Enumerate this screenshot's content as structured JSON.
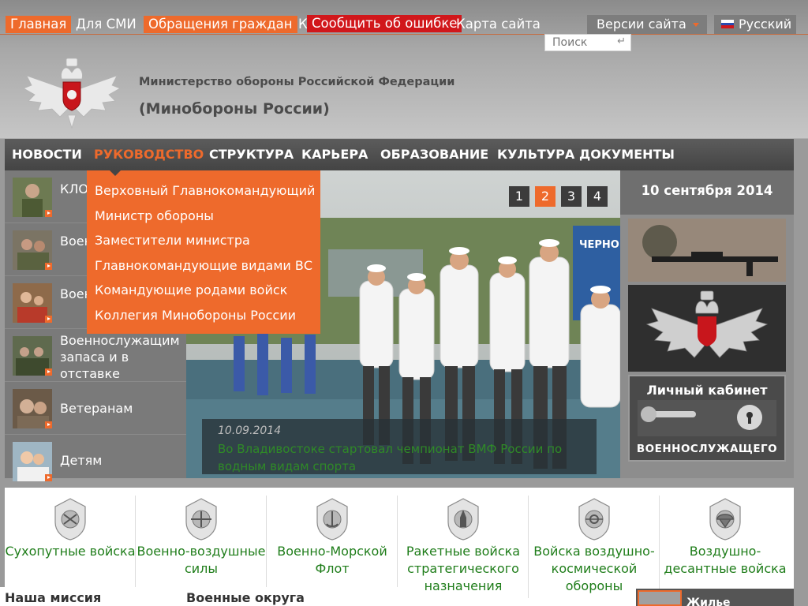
{
  "topbar": {
    "links": [
      {
        "label": "Главная",
        "style": "orange"
      },
      {
        "label": "Для СМИ",
        "style": "plain"
      },
      {
        "label": "Обращения граждан",
        "style": "orange"
      },
      {
        "label": "К",
        "style": "plain"
      },
      {
        "label": "Сообщить об ошибке",
        "style": "red"
      },
      {
        "label": "Карта сайта",
        "style": "plain"
      }
    ],
    "versions_label": "Версии сайта",
    "language_label": "Русский",
    "search_placeholder": "Поиск",
    "search_enter_icon": "↵"
  },
  "header": {
    "org_name": "Министерство обороны Российской Федерации",
    "org_short": "(Минобороны России)",
    "logo_icon": "double-headed-eagle-emblem"
  },
  "mainnav": {
    "items": [
      {
        "label": "НОВОСТИ",
        "active": false
      },
      {
        "label": "РУКОВОДСТВО",
        "active": true
      },
      {
        "label": "СТРУКТУРА",
        "active": false
      },
      {
        "label": "КАРЬЕРА",
        "active": false
      },
      {
        "label": "ОБРАЗОВАНИЕ",
        "active": false
      },
      {
        "label": "КУЛЬТУРА",
        "active": false
      },
      {
        "label": "ДОКУМЕНТЫ",
        "active": false
      }
    ]
  },
  "dropdown": {
    "items": [
      "Верховный Главнокомандующий",
      "Министр обороны",
      "Заместители министра",
      "Главнокомандующие видами ВС",
      "Командующие родами войск",
      "Коллегия Минобороны России"
    ]
  },
  "sidebar": {
    "items": [
      {
        "label": "КЛОПЬ Приз"
      },
      {
        "label": "Военн по к"
      },
      {
        "label": "Военн по к"
      },
      {
        "label": "Военнослужащим запаса и в отставке"
      },
      {
        "label": "Ветеранам"
      },
      {
        "label": "Детям"
      }
    ]
  },
  "slider": {
    "pages": [
      "1",
      "2",
      "3",
      "4"
    ],
    "active_page": 2,
    "date": "10.09.2014",
    "headline": "Во Владивостоке стартовал чемпионат ВМФ России по водным видам спорта",
    "banner_text": "ЧЕРНО"
  },
  "rightcol": {
    "date": "10 сентября 2014",
    "cabinet_title": "Личный кабинет",
    "cabinet_subtitle": "ВОЕННОСЛУЖАЩЕГО"
  },
  "troops": {
    "items": [
      "Сухопутные войска",
      "Военно-воздушные силы",
      "Военно-Морской Флот",
      "Ракетные войска стратегического назначения",
      "Войска воздушно-космической обороны",
      "Воздушно-десантные войска"
    ]
  },
  "bottom": {
    "mission_title": "Наша миссия",
    "districts_title": "Военные округа",
    "housing_label": "Жилье"
  },
  "colors": {
    "accent": "#ee6a2c",
    "error_red": "#d1171b",
    "nav_bg": "#4e4e4e",
    "troop_link": "#1f7d1a",
    "caption_link": "#2f8a27"
  }
}
